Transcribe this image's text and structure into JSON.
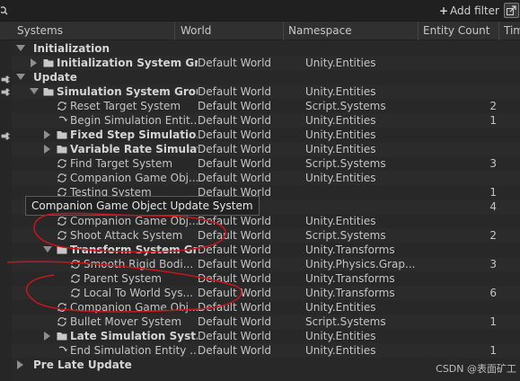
{
  "toolbar": {
    "add_filter_label": "Add filter",
    "add_filter_plus": "+"
  },
  "columns": {
    "systems": "Systems",
    "world": "World",
    "namespace": "Namespace",
    "entity_count": "Entity Count",
    "time": "Tim"
  },
  "rows": [
    {
      "indent": 0,
      "kind": "group-header",
      "expand": "open",
      "name": "Initialization",
      "world": "",
      "namespace": "",
      "count": ""
    },
    {
      "indent": 1,
      "kind": "group",
      "expand": "closed",
      "name": "Initialization System Gr...",
      "world": "Default World",
      "namespace": "Unity.Entities",
      "count": ""
    },
    {
      "indent": 0,
      "kind": "group-header",
      "expand": "open",
      "name": "Update",
      "world": "",
      "namespace": "",
      "count": ""
    },
    {
      "indent": 1,
      "kind": "group",
      "expand": "open",
      "name": "Simulation System Group",
      "world": "Default World",
      "namespace": "Unity.Entities",
      "count": ""
    },
    {
      "indent": 2,
      "kind": "system",
      "name": "Reset Target System",
      "world": "Default World",
      "namespace": "Script.Systems",
      "count": "2"
    },
    {
      "indent": 2,
      "kind": "cmd",
      "name": "Begin Simulation Entit...",
      "world": "Default World",
      "namespace": "Unity.Entities",
      "count": "1"
    },
    {
      "indent": 2,
      "kind": "group",
      "expand": "closed",
      "name": "Fixed Step Simulatio...",
      "world": "Default World",
      "namespace": "Unity.Entities",
      "count": ""
    },
    {
      "indent": 2,
      "kind": "group",
      "expand": "closed",
      "name": "Variable Rate Simulat...",
      "world": "Default World",
      "namespace": "Unity.Entities",
      "count": ""
    },
    {
      "indent": 2,
      "kind": "system",
      "name": "Find Target System",
      "world": "Default World",
      "namespace": "Script.Systems",
      "count": "3"
    },
    {
      "indent": 2,
      "kind": "system",
      "name": "Companion Game Obj...",
      "world": "Default World",
      "namespace": "Unity.Entities",
      "count": ""
    },
    {
      "indent": 2,
      "kind": "system",
      "name": "Testing System",
      "world": "Default World",
      "namespace": "",
      "count": "1"
    },
    {
      "indent": 2,
      "kind": "system",
      "name": "",
      "world": "World",
      "namespace": "",
      "count": "4"
    },
    {
      "indent": 2,
      "kind": "system",
      "name": "Companion Game Obj...",
      "world": "Default World",
      "namespace": "Unity.Entities",
      "count": ""
    },
    {
      "indent": 2,
      "kind": "system",
      "name": "Shoot Attack System",
      "world": "Default World",
      "namespace": "Script.Systems",
      "count": "2"
    },
    {
      "indent": 2,
      "kind": "group",
      "expand": "open",
      "name": "Transform System Gr...",
      "world": "Default World",
      "namespace": "Unity.Transforms",
      "count": ""
    },
    {
      "indent": 3,
      "kind": "system",
      "name": "Smooth Rigid Bodi...",
      "world": "Default World",
      "namespace": "Unity.Physics.Grap...",
      "count": "3"
    },
    {
      "indent": 3,
      "kind": "system",
      "name": "Parent System",
      "world": "Default World",
      "namespace": "Unity.Transforms",
      "count": ""
    },
    {
      "indent": 3,
      "kind": "system",
      "name": "Local To World Sys...",
      "world": "Default World",
      "namespace": "Unity.Transforms",
      "count": "6"
    },
    {
      "indent": 2,
      "kind": "system",
      "name": "Companion Game Obj...",
      "world": "Default World",
      "namespace": "Unity.Entities",
      "count": ""
    },
    {
      "indent": 2,
      "kind": "system",
      "name": "Bullet Mover System",
      "world": "Default World",
      "namespace": "Script.Systems",
      "count": "1"
    },
    {
      "indent": 2,
      "kind": "group",
      "expand": "closed",
      "name": "Late Simulation Syst...",
      "world": "Default World",
      "namespace": "Unity.Entities",
      "count": ""
    },
    {
      "indent": 2,
      "kind": "cmd",
      "name": "End Simulation Entity ...",
      "world": "Default World",
      "namespace": "Unity.Entities",
      "count": "1"
    },
    {
      "indent": 0,
      "kind": "group-header",
      "expand": "closed",
      "name": "Pre Late Update",
      "world": "",
      "namespace": "",
      "count": ""
    }
  ],
  "tooltip": "Companion Game Object Update System",
  "watermark": "CSDN @表面矿工",
  "icons": {
    "search": "search-icon",
    "system": "system-cycle-icon",
    "command_buffer": "command-buffer-icon",
    "folder": "folder-icon",
    "pin": "plug-pin-icon",
    "dock": "dock-corner-icon"
  },
  "colors": {
    "background": "#282828",
    "toolbar": "#202020",
    "header": "#303030",
    "text": "#c4c4c4",
    "annotation_red": "#c8161d"
  }
}
